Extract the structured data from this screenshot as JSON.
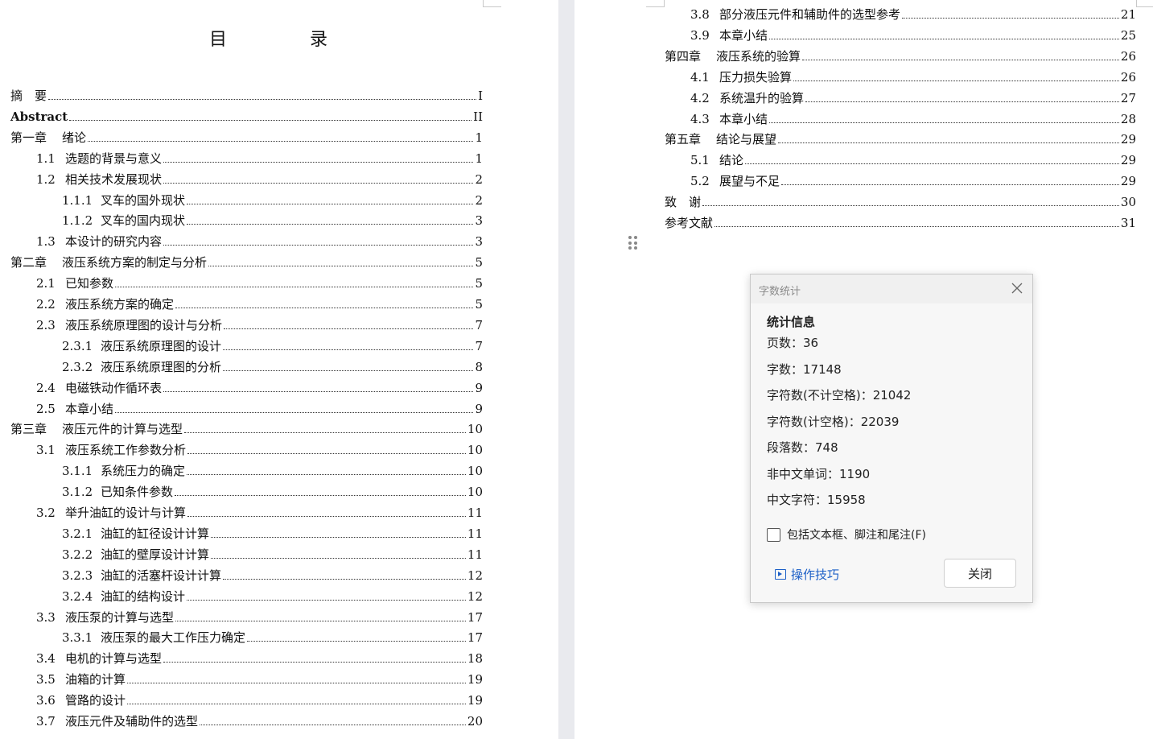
{
  "toc_title": "目 录",
  "left_entries": [
    {
      "num": "",
      "text": "摘　要",
      "page": "I"
    },
    {
      "num": "",
      "text": "Abstract",
      "page": "II"
    },
    {
      "num": "第一章",
      "text": "绪论",
      "page": "1"
    },
    {
      "num": "1.1",
      "text": "选题的背景与意义",
      "page": "1"
    },
    {
      "num": "1.2",
      "text": "相关技术发展现状",
      "page": "2"
    },
    {
      "num": "1.1.1",
      "text": "叉车的国外现状",
      "page": "2"
    },
    {
      "num": "1.1.2",
      "text": "叉车的国内现状",
      "page": "3"
    },
    {
      "num": "1.3",
      "text": "本设计的研究内容",
      "page": "3"
    },
    {
      "num": "第二章",
      "text": "液压系统方案的制定与分析",
      "page": "5"
    },
    {
      "num": "2.1",
      "text": "已知参数",
      "page": "5"
    },
    {
      "num": "2.2",
      "text": "液压系统方案的确定",
      "page": "5"
    },
    {
      "num": "2.3",
      "text": "液压系统原理图的设计与分析",
      "page": "7"
    },
    {
      "num": "2.3.1",
      "text": "液压系统原理图的设计",
      "page": "7"
    },
    {
      "num": "2.3.2",
      "text": "液压系统原理图的分析",
      "page": "8"
    },
    {
      "num": "2.4",
      "text": "电磁铁动作循环表",
      "page": "9"
    },
    {
      "num": "2.5",
      "text": "本章小结",
      "page": "9"
    },
    {
      "num": "第三章",
      "text": "液压元件的计算与选型",
      "page": "10"
    },
    {
      "num": "3.1",
      "text": "液压系统工作参数分析",
      "page": "10"
    },
    {
      "num": "3.1.1",
      "text": "系统压力的确定",
      "page": "10"
    },
    {
      "num": "3.1.2",
      "text": "已知条件参数",
      "page": "10"
    },
    {
      "num": "3.2",
      "text": "举升油缸的设计与计算",
      "page": "11"
    },
    {
      "num": "3.2.1",
      "text": "油缸的缸径设计计算",
      "page": "11"
    },
    {
      "num": "3.2.2",
      "text": "油缸的壁厚设计计算",
      "page": "11"
    },
    {
      "num": "3.2.3",
      "text": "油缸的活塞杆设计计算",
      "page": "12"
    },
    {
      "num": "3.2.4",
      "text": "油缸的结构设计",
      "page": "12"
    },
    {
      "num": "3.3",
      "text": "液压泵的计算与选型",
      "page": "17"
    },
    {
      "num": "3.3.1",
      "text": "液压泵的最大工作压力确定",
      "page": "17"
    },
    {
      "num": "3.4",
      "text": "电机的计算与选型",
      "page": "18"
    },
    {
      "num": "3.5",
      "text": "油箱的计算",
      "page": "19"
    },
    {
      "num": "3.6",
      "text": "管路的设计",
      "page": "19"
    },
    {
      "num": "3.7",
      "text": "液压元件及辅助件的选型",
      "page": "20"
    }
  ],
  "right_entries": [
    {
      "num": "3.8",
      "text": "部分液压元件和辅助件的选型参考",
      "page": "21"
    },
    {
      "num": "3.9",
      "text": "本章小结",
      "page": "25"
    },
    {
      "num": "第四章",
      "text": "液压系统的验算",
      "page": "26"
    },
    {
      "num": "4.1",
      "text": "压力损失验算",
      "page": "26"
    },
    {
      "num": "4.2",
      "text": "系统温升的验算",
      "page": "27"
    },
    {
      "num": "4.3",
      "text": "本章小结",
      "page": "28"
    },
    {
      "num": "第五章",
      "text": "结论与展望",
      "page": "29"
    },
    {
      "num": "5.1",
      "text": "结论",
      "page": "29"
    },
    {
      "num": "5.2",
      "text": "展望与不足",
      "page": "29"
    },
    {
      "num": "",
      "text": "致　谢",
      "page": "30"
    },
    {
      "num": "",
      "text": "参考文献",
      "page": "31"
    }
  ],
  "dialog": {
    "title": "字数统计",
    "section_heading": "统计信息",
    "stats": [
      "页数：36",
      "字数：17148",
      "字符数(不计空格)：21042",
      "字符数(计空格)：22039",
      "段落数：748",
      "非中文单词：1190",
      "中文字符：15958"
    ],
    "checkbox_label": "包括文本框、脚注和尾注(F)",
    "checkbox_checked": false,
    "tips_label": "操作技巧",
    "close_button": "关闭"
  }
}
